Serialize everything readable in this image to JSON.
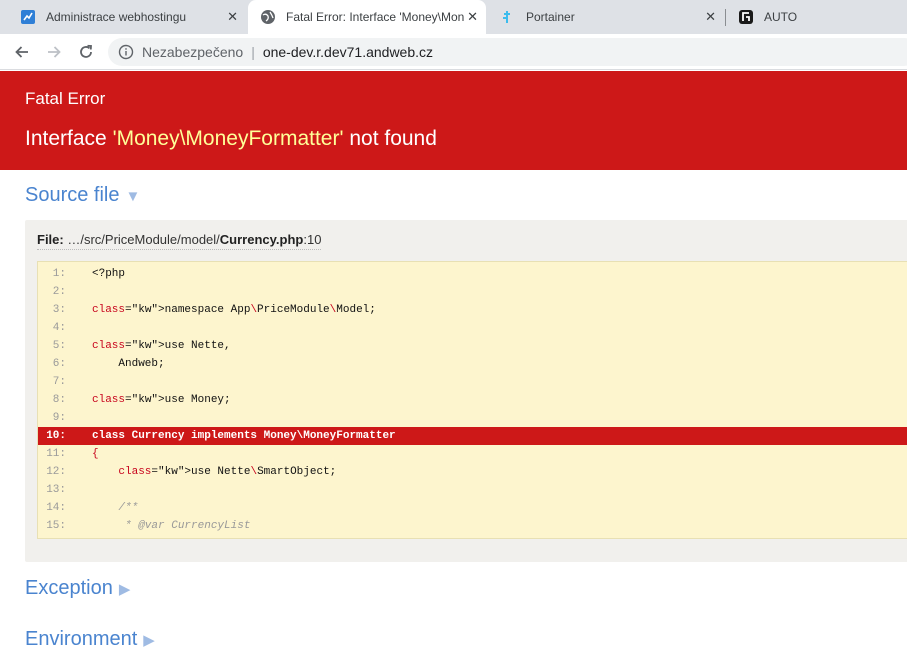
{
  "tabs": [
    {
      "title": "Administrace webhostingu",
      "icon": "hosting-icon",
      "active": false
    },
    {
      "title": "Fatal Error: Interface 'Money\\Mon",
      "icon": "globe-icon",
      "active": true
    },
    {
      "title": "Portainer",
      "icon": "portainer-icon",
      "active": false
    },
    {
      "title": "AUTO",
      "icon": "auto-icon",
      "active": false
    }
  ],
  "address": {
    "security": "Nezabezpečeno",
    "url": "one-dev.r.dev71.andweb.cz"
  },
  "error": {
    "type": "Fatal Error",
    "msg_prefix": "Interface ",
    "msg_highlight": "'Money\\MoneyFormatter'",
    "msg_suffix": " not found"
  },
  "sections": {
    "source": "Source file",
    "exception": "Exception",
    "environment": "Environment"
  },
  "file": {
    "label": "File:",
    "path": " …/src/PriceModule/model/",
    "name": "Currency.php",
    "line": ":10"
  },
  "code_lines": [
    {
      "num": "1:",
      "text": "<?php"
    },
    {
      "num": "2:",
      "text": ""
    },
    {
      "num": "3:",
      "text": "namespace App\\PriceModule\\Model;"
    },
    {
      "num": "4:",
      "text": ""
    },
    {
      "num": "5:",
      "text": "use Nette,"
    },
    {
      "num": "6:",
      "text": "    Andweb;"
    },
    {
      "num": "7:",
      "text": ""
    },
    {
      "num": "8:",
      "text": "use Money;"
    },
    {
      "num": "9:",
      "text": ""
    },
    {
      "num": "10:",
      "text": "class Currency implements Money\\MoneyFormatter"
    },
    {
      "num": "11:",
      "text": "{"
    },
    {
      "num": "12:",
      "text": "    use Nette\\SmartObject;"
    },
    {
      "num": "13:",
      "text": ""
    },
    {
      "num": "14:",
      "text": "    /**"
    },
    {
      "num": "15:",
      "text": "     * @var CurrencyList"
    }
  ],
  "highlight_line": "10:",
  "colors": {
    "error_red": "#cd1818",
    "link_blue": "#4a84cf",
    "code_bg": "#fdf5ce"
  }
}
